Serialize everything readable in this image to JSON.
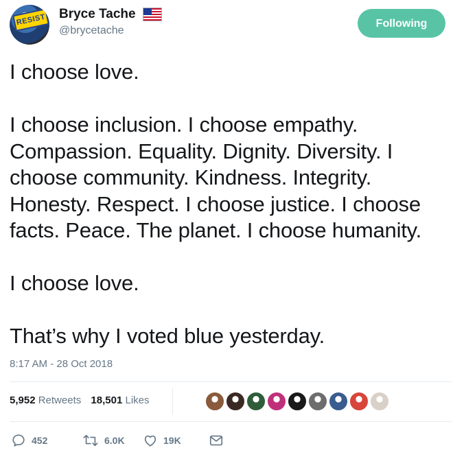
{
  "author": {
    "name": "Bryce Tache",
    "handle": "@brycetache",
    "avatar_sign_text": "RESIST",
    "flag_icon": "us-flag-icon"
  },
  "follow_button": {
    "label": "Following",
    "color": "#59c3a6"
  },
  "tweet": {
    "text": "I choose love.\n\nI choose inclusion. I choose empathy. Compassion. Equality. Dignity. Diversity. I choose community. Kindness. Integrity. Honesty. Respect. I choose justice. I choose facts. Peace. The planet. I choose humanity.\n\nI choose love.\n\nThat’s why I voted blue yesterday.",
    "timestamp": "8:17 AM - 28 Oct 2018"
  },
  "stats": {
    "retweets_count": "5,952",
    "retweets_label": "Retweets",
    "likes_count": "18,501",
    "likes_label": "Likes"
  },
  "likers": [
    {
      "name": "liker-avatar-1",
      "color": "#8a5a3c"
    },
    {
      "name": "liker-avatar-2",
      "color": "#3b2a24"
    },
    {
      "name": "liker-avatar-3",
      "color": "#2f5d3a"
    },
    {
      "name": "liker-avatar-4",
      "color": "#c0307a"
    },
    {
      "name": "liker-avatar-5",
      "color": "#1a1a1a"
    },
    {
      "name": "liker-avatar-6",
      "color": "#6d6d6d"
    },
    {
      "name": "liker-avatar-7",
      "color": "#3a5d8f"
    },
    {
      "name": "liker-avatar-8",
      "color": "#d8453a"
    },
    {
      "name": "liker-avatar-9",
      "color": "#d9d0c8"
    }
  ],
  "actions": {
    "reply": {
      "icon": "reply-icon",
      "count": "452"
    },
    "retweet": {
      "icon": "retweet-icon",
      "count": "6.0K"
    },
    "like": {
      "icon": "heart-icon",
      "count": "19K"
    },
    "message": {
      "icon": "envelope-icon"
    }
  },
  "colors": {
    "text": "#14171a",
    "secondary": "#657786",
    "divider": "#e6ecf0"
  }
}
